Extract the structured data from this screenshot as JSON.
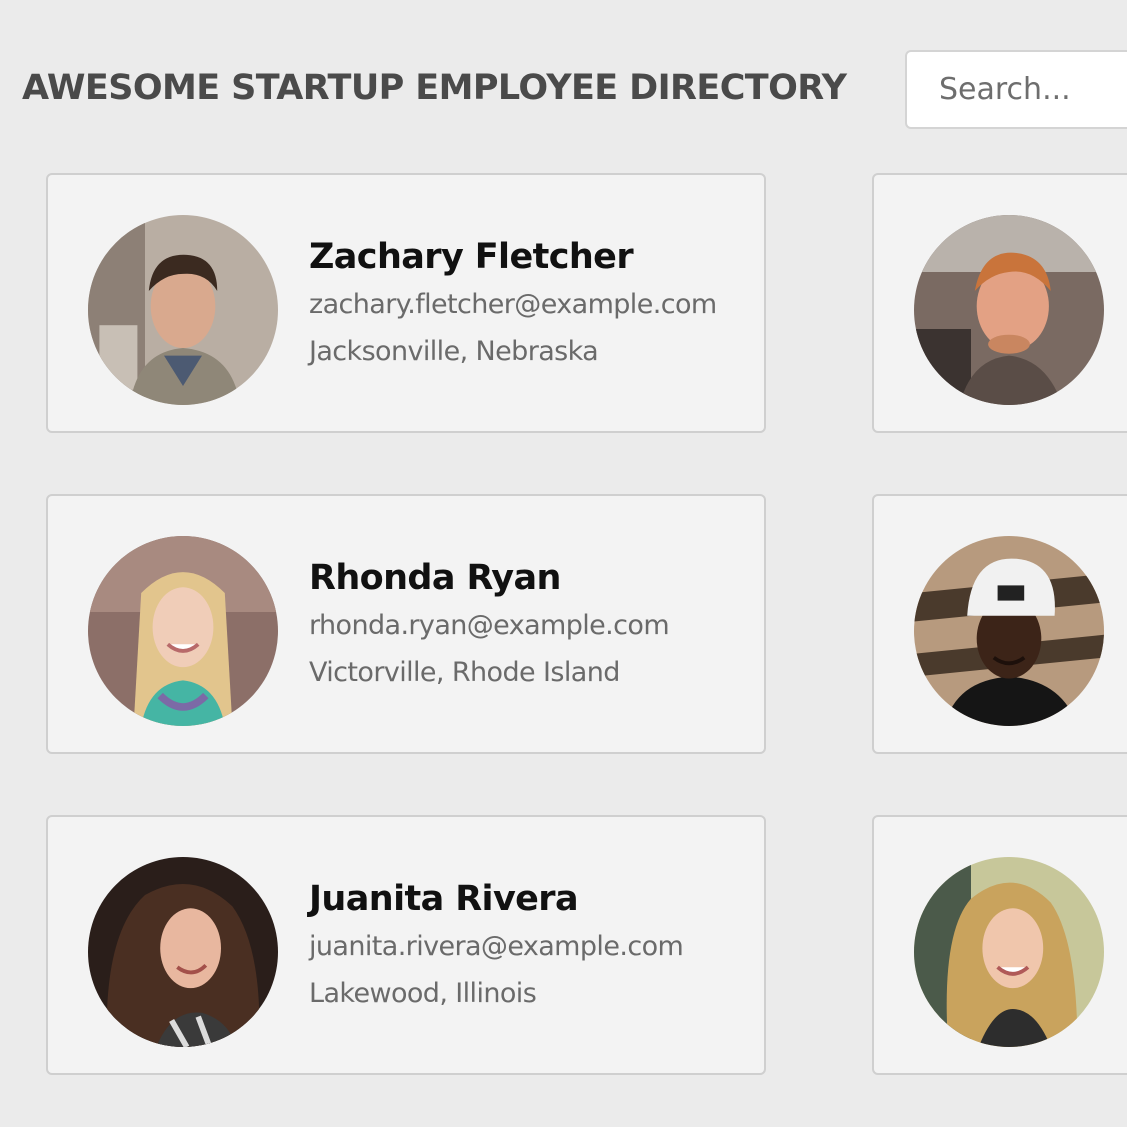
{
  "header": {
    "title": "AWESOME STARTUP EMPLOYEE DIRECTORY",
    "search_placeholder": "Search..."
  },
  "employees": [
    {
      "name": "Zachary Fletcher",
      "email": "zachary.fletcher@example.com",
      "location": "Jacksonville, Nebraska",
      "avatar_icon": "person-photo-icon"
    },
    {
      "name": "Rhonda Ryan",
      "email": "rhonda.ryan@example.com",
      "location": "Victorville, Rhode Island",
      "avatar_icon": "person-photo-icon"
    },
    {
      "name": "Juanita Rivera",
      "email": "juanita.rivera@example.com",
      "location": "Lakewood, Illinois",
      "avatar_icon": "person-photo-icon"
    },
    {
      "avatar_icon": "person-photo-icon"
    },
    {
      "avatar_icon": "person-photo-icon"
    },
    {
      "avatar_icon": "person-photo-icon"
    }
  ],
  "colors": {
    "page_bg": "#ebebeb",
    "card_bg": "#f3f3f3",
    "card_border": "#cfcfcf",
    "title": "#4a4a4a",
    "name": "#111111",
    "detail": "#6a6a6a"
  }
}
